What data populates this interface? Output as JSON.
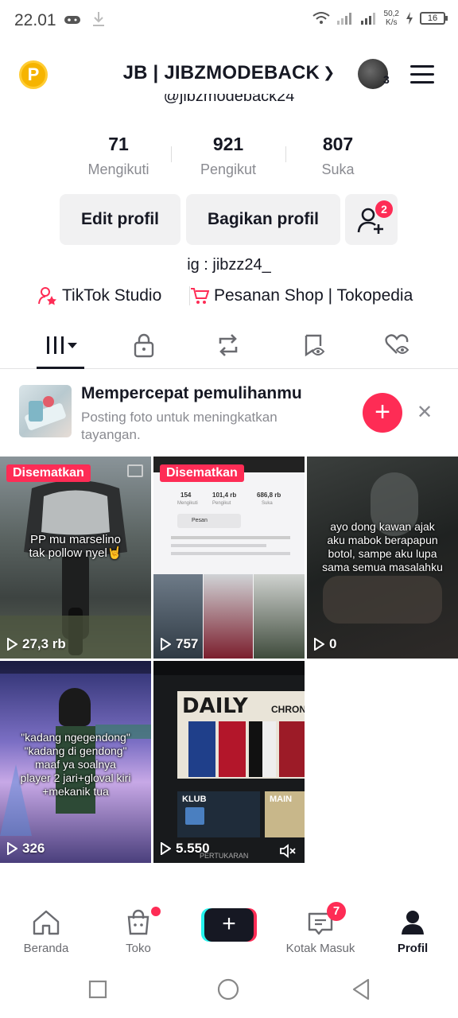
{
  "status": {
    "time": "22.01",
    "net_speed_value": "50,2",
    "net_speed_unit": "K/s",
    "battery": "16"
  },
  "header": {
    "username": "JB | JIBZMODEBACK",
    "handle": "@jibzmodeback24",
    "avatar_count": "3",
    "coin_label": "P"
  },
  "stats": [
    {
      "value": "71",
      "label": "Mengikuti"
    },
    {
      "value": "921",
      "label": "Pengikut"
    },
    {
      "value": "807",
      "label": "Suka"
    }
  ],
  "buttons": {
    "edit": "Edit profil",
    "share": "Bagikan profil",
    "add_friend_badge": "2"
  },
  "bio": "ig : jibzz24_",
  "links": {
    "studio": "TikTok Studio",
    "shop": "Pesanan Shop | Tokopedia"
  },
  "banner": {
    "title": "Mempercepat pemulihanmu",
    "subtitle": "Posting foto untuk meningkatkan tayangan."
  },
  "videos": [
    {
      "pinned": "Disematkan",
      "views": "27,3 rb",
      "caption": "PP mu marselino\ntak pollow nyel🤘"
    },
    {
      "pinned": "Disematkan",
      "views": "757",
      "caption": ""
    },
    {
      "pinned": "",
      "views": "0",
      "caption": "ayo dong kawan ajak\naku mabok berapapun\nbotol, sampe aku lupa\nsama semua masalahku"
    },
    {
      "pinned": "",
      "views": "326",
      "caption": "\"kadang ngegendong\"\n\"kadang di gendong\"\nmaaf ya soalnya\nplayer 2 jari+gloval kiri\n+mekanik tua"
    },
    {
      "pinned": "",
      "views": "5.550",
      "caption": ""
    }
  ],
  "screenshot_text": {
    "stats_nums": [
      "154",
      "101,4 rb",
      "686,8 rb"
    ],
    "stats_labels": [
      "Mengikuti",
      "Pengikut",
      "Suka"
    ],
    "pesan": "Pesan",
    "daily": "DAILY",
    "chron": "CHRON",
    "klub": "KLUB",
    "main": "MAIN",
    "pertukaran": "PERTUKARAN"
  },
  "nav": {
    "home": "Beranda",
    "shop": "Toko",
    "inbox": "Kotak Masuk",
    "inbox_badge": "7",
    "profile": "Profil"
  },
  "colors": {
    "accent": "#fe2c55",
    "cyan": "#25f4ee",
    "text": "#161823",
    "muted": "#8a8b91"
  }
}
